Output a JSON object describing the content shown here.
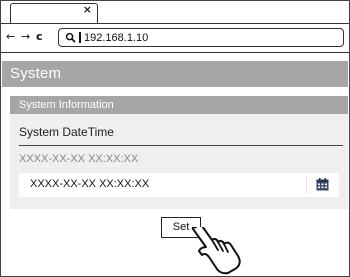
{
  "browser": {
    "tab_close": "×",
    "nav": {
      "back": "←",
      "forward": "→",
      "reload": "c"
    },
    "url": "192.168.1.10"
  },
  "page": {
    "title": "System",
    "panel": {
      "title": "System Information",
      "field_label": "System DateTime",
      "current_value": "XXXX-XX-XX XX:XX:XX",
      "input_value": "XXXX-XX-XX XX:XX:XX"
    },
    "set_button": "Set"
  },
  "colors": {
    "header_gray": "#a6a6a6",
    "panel_bg": "#efefef"
  },
  "icons": [
    "close-icon",
    "back-arrow-icon",
    "forward-arrow-icon",
    "reload-icon",
    "search-icon",
    "calendar-icon",
    "pointer-hand-icon"
  ]
}
